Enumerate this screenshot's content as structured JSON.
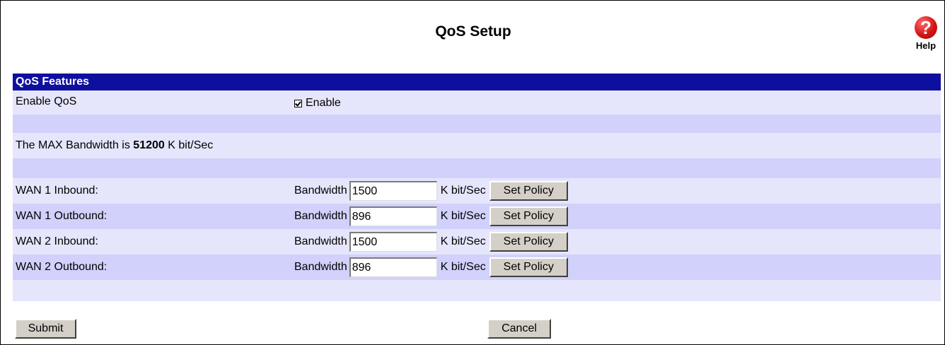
{
  "page": {
    "title": "QoS Setup",
    "help_label": "Help",
    "help_icon": "question-mark-icon",
    "help_glyph": "?"
  },
  "section": {
    "title": "QoS Features"
  },
  "enable_qos": {
    "label": "Enable QoS",
    "checkbox_label": "Enable",
    "checked": true
  },
  "max_bandwidth": {
    "prefix": "The MAX Bandwidth is ",
    "value": "51200",
    "suffix": " K bit/Sec"
  },
  "wan_rows": [
    {
      "label": "WAN 1 Inbound:",
      "bw_label": "Bandwidth",
      "value": "1500",
      "unit": "K bit/Sec",
      "button": "Set Policy"
    },
    {
      "label": "WAN 1 Outbound:",
      "bw_label": "Bandwidth",
      "value": "896",
      "unit": "K bit/Sec",
      "button": "Set Policy"
    },
    {
      "label": "WAN 2 Inbound:",
      "bw_label": "Bandwidth",
      "value": "1500",
      "unit": "K bit/Sec",
      "button": "Set Policy"
    },
    {
      "label": "WAN 2 Outbound:",
      "bw_label": "Bandwidth",
      "value": "896",
      "unit": "K bit/Sec",
      "button": "Set Policy"
    }
  ],
  "actions": {
    "submit": "Submit",
    "cancel": "Cancel"
  },
  "colors": {
    "header_bg": "#0f0f9f",
    "row_light": "#e5e5fc",
    "row_mid": "#d1d1fb",
    "button_bg": "#d4d0c8",
    "help_icon": "#d41515"
  }
}
